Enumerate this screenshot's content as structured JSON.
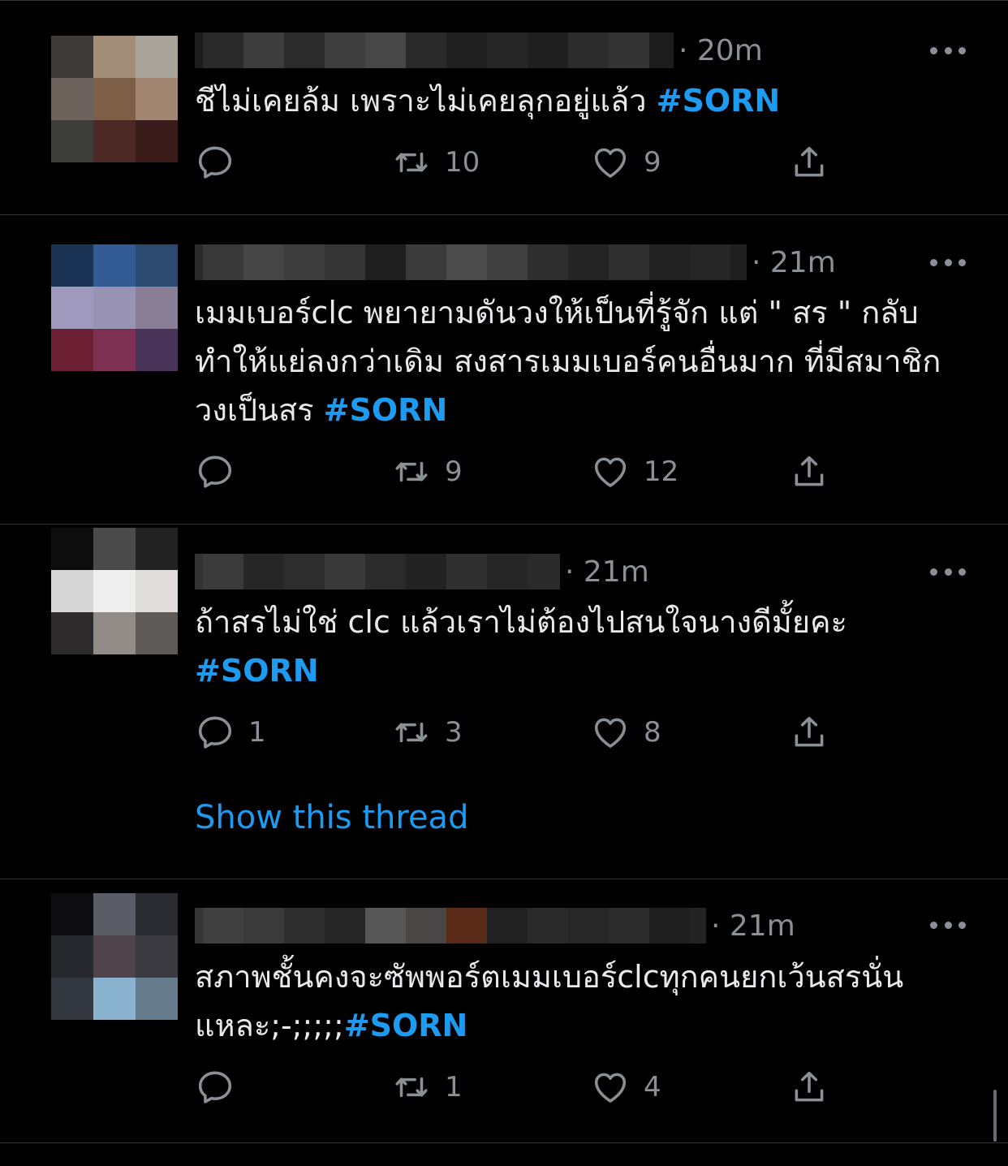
{
  "colors": {
    "background": "#000000",
    "text": "#e7e9ea",
    "muted": "#8b9096",
    "accent": "#1d9bf0",
    "divider": "#2f3336"
  },
  "icons": {
    "reply": "speech-bubble-icon",
    "retweet": "retweet-arrows-icon",
    "like": "heart-icon",
    "share": "share-upload-icon",
    "more": "three-dots-icon"
  },
  "tweets": [
    {
      "time": "· 20m",
      "text": "ชีไม่เคยล้ม เพราะไม่เคยลุกอยู่แล้ว ",
      "hashtag": "#SORN",
      "reply_count": "",
      "retweet_count": "10",
      "like_count": "9"
    },
    {
      "time": "· 21m",
      "text": "เมมเบอร์clc พยายามดันวงให้เป็นที่รู้จัก แต่ \" สร \" กลับทำให้แย่ลงกว่าเดิม สงสารเมมเบอร์คนอื่นมาก ที่มีสมาชิกวงเป็นสร ",
      "hashtag": "#SORN",
      "reply_count": "",
      "retweet_count": "9",
      "like_count": "12"
    },
    {
      "time": "· 21m",
      "text": "ถ้าสรไม่ใช่ clc แล้วเราไม่ต้องไปสนใจนางดีมั้ยคะ ",
      "hashtag": "#SORN",
      "reply_count": "1",
      "retweet_count": "3",
      "like_count": "8",
      "show_thread": "Show this thread"
    },
    {
      "time": "· 21m",
      "text": "สภาพชั้นคงจะซัพพอร์ตเมมเบอร์clcทุกคนยกเว้นสรนั่นแหละ;-;;;;;",
      "hashtag": "#SORN",
      "reply_count": "",
      "retweet_count": "1",
      "like_count": "4"
    }
  ]
}
